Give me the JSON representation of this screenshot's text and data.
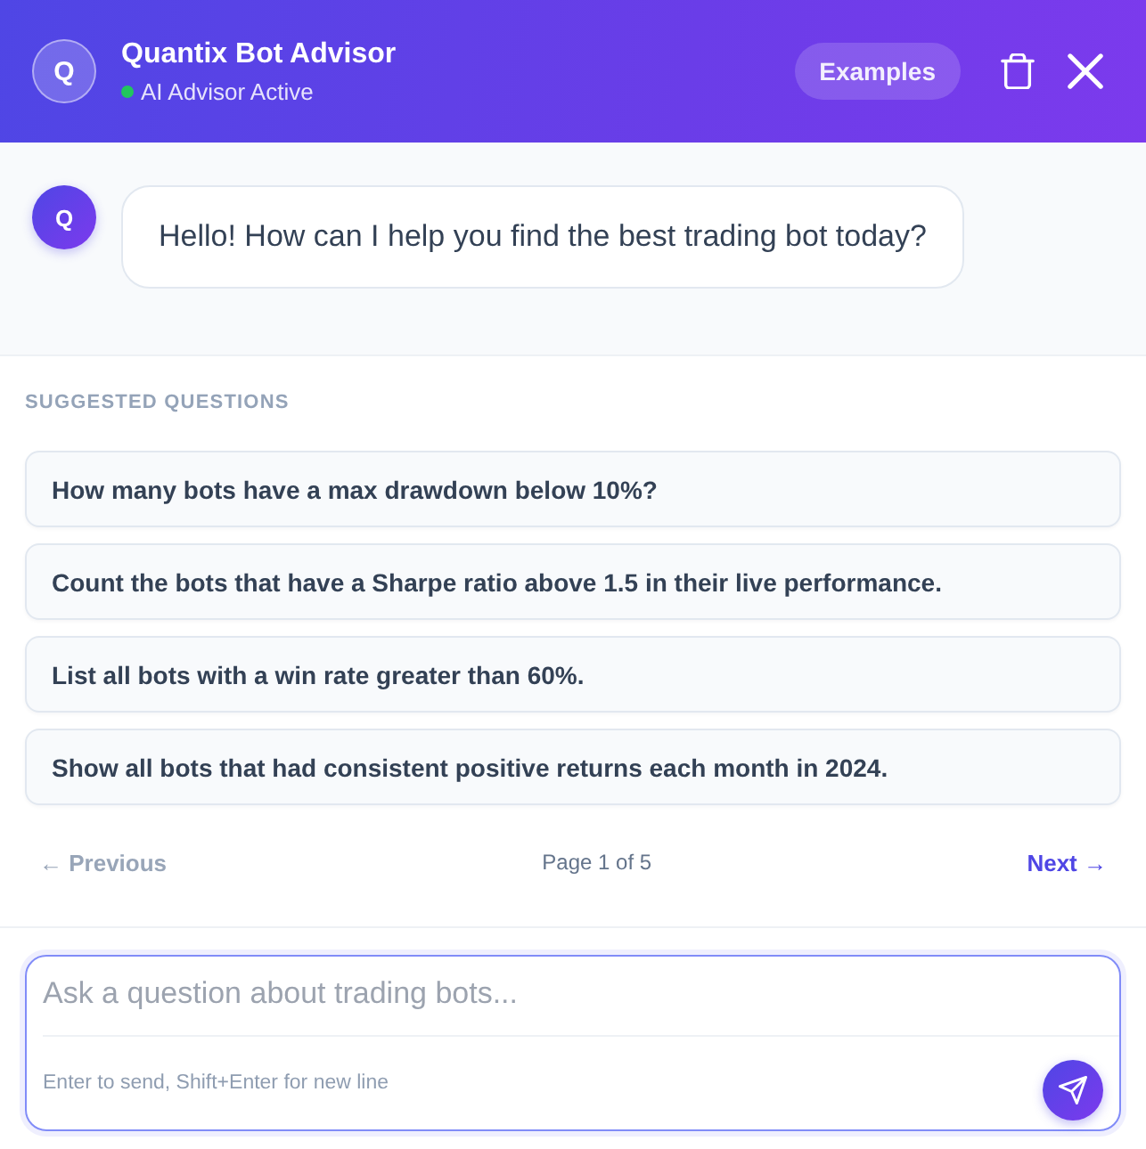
{
  "header": {
    "avatar": "Q",
    "title": "Quantix Bot Advisor",
    "status": {
      "label": "AI Advisor Active",
      "active": true
    },
    "examples_button": "Examples"
  },
  "messages": [
    {
      "kind": "bot",
      "avatar": "Q",
      "text": "Hello! How can I help you find the best trading bot today?"
    }
  ],
  "suggestions": {
    "heading": "SUGGESTED QUESTIONS",
    "questions": [
      "How many bots have a max drawdown below 10%?",
      "Count the bots that have a Sharpe ratio above 1.5 in their live performance.",
      "List all bots with a win rate greater than 60%.",
      "Show all bots that had consistent positive returns each month in 2024."
    ]
  },
  "pagination": {
    "previous": {
      "label": "← Previous",
      "disabled": true
    },
    "page": "Page 1 of 5",
    "next": {
      "label": "Next →",
      "disabled": false
    }
  },
  "composer": {
    "placeholder": "Ask a question about trading bots...",
    "hint": "Enter to send, Shift+Enter for new line"
  }
}
